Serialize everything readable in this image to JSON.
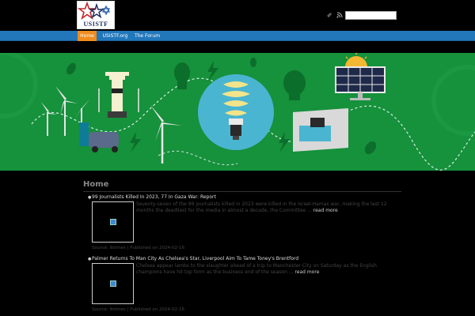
{
  "header": {
    "logo_text": "USISTF",
    "search": {
      "placeholder": "",
      "value": ""
    },
    "social": [
      "share-icon",
      "rss-icon"
    ]
  },
  "nav": {
    "items": [
      {
        "label": "Home",
        "active": true
      },
      {
        "label": "USISTF.org",
        "active": false
      },
      {
        "label": "The Forum",
        "active": false
      }
    ]
  },
  "colors": {
    "nav_bar": "#2277bb",
    "nav_active": "#f08c1e",
    "banner_green": "#16913c",
    "background": "#000000"
  },
  "main": {
    "title": "Home",
    "articles": [
      {
        "title": "99 Journalists Killed In 2023, 77 In Gaza War: Report",
        "excerpt": "Seventy-seven of the 99 journalists killed in 2023 were killed in the Israel-Hamas war, making the last 12 months the deadliest for the media in almost a decade, the Committee ...",
        "read_more": "read more",
        "source": "Source: ibtimes | Published on 2024-02-16"
      },
      {
        "title": "Palmer Returns To Man City As Chelsea's Star, Liverpool Aim To Tame Toney's Brentford",
        "excerpt": "Chelsea appear lambs to the slaughter ahead of a trip to Manchester City on Saturday as the English champions have hit top form as the business end of the season ...",
        "read_more": "read more",
        "source": "Source: ibtimes | Published on 2024-02-16"
      }
    ]
  }
}
